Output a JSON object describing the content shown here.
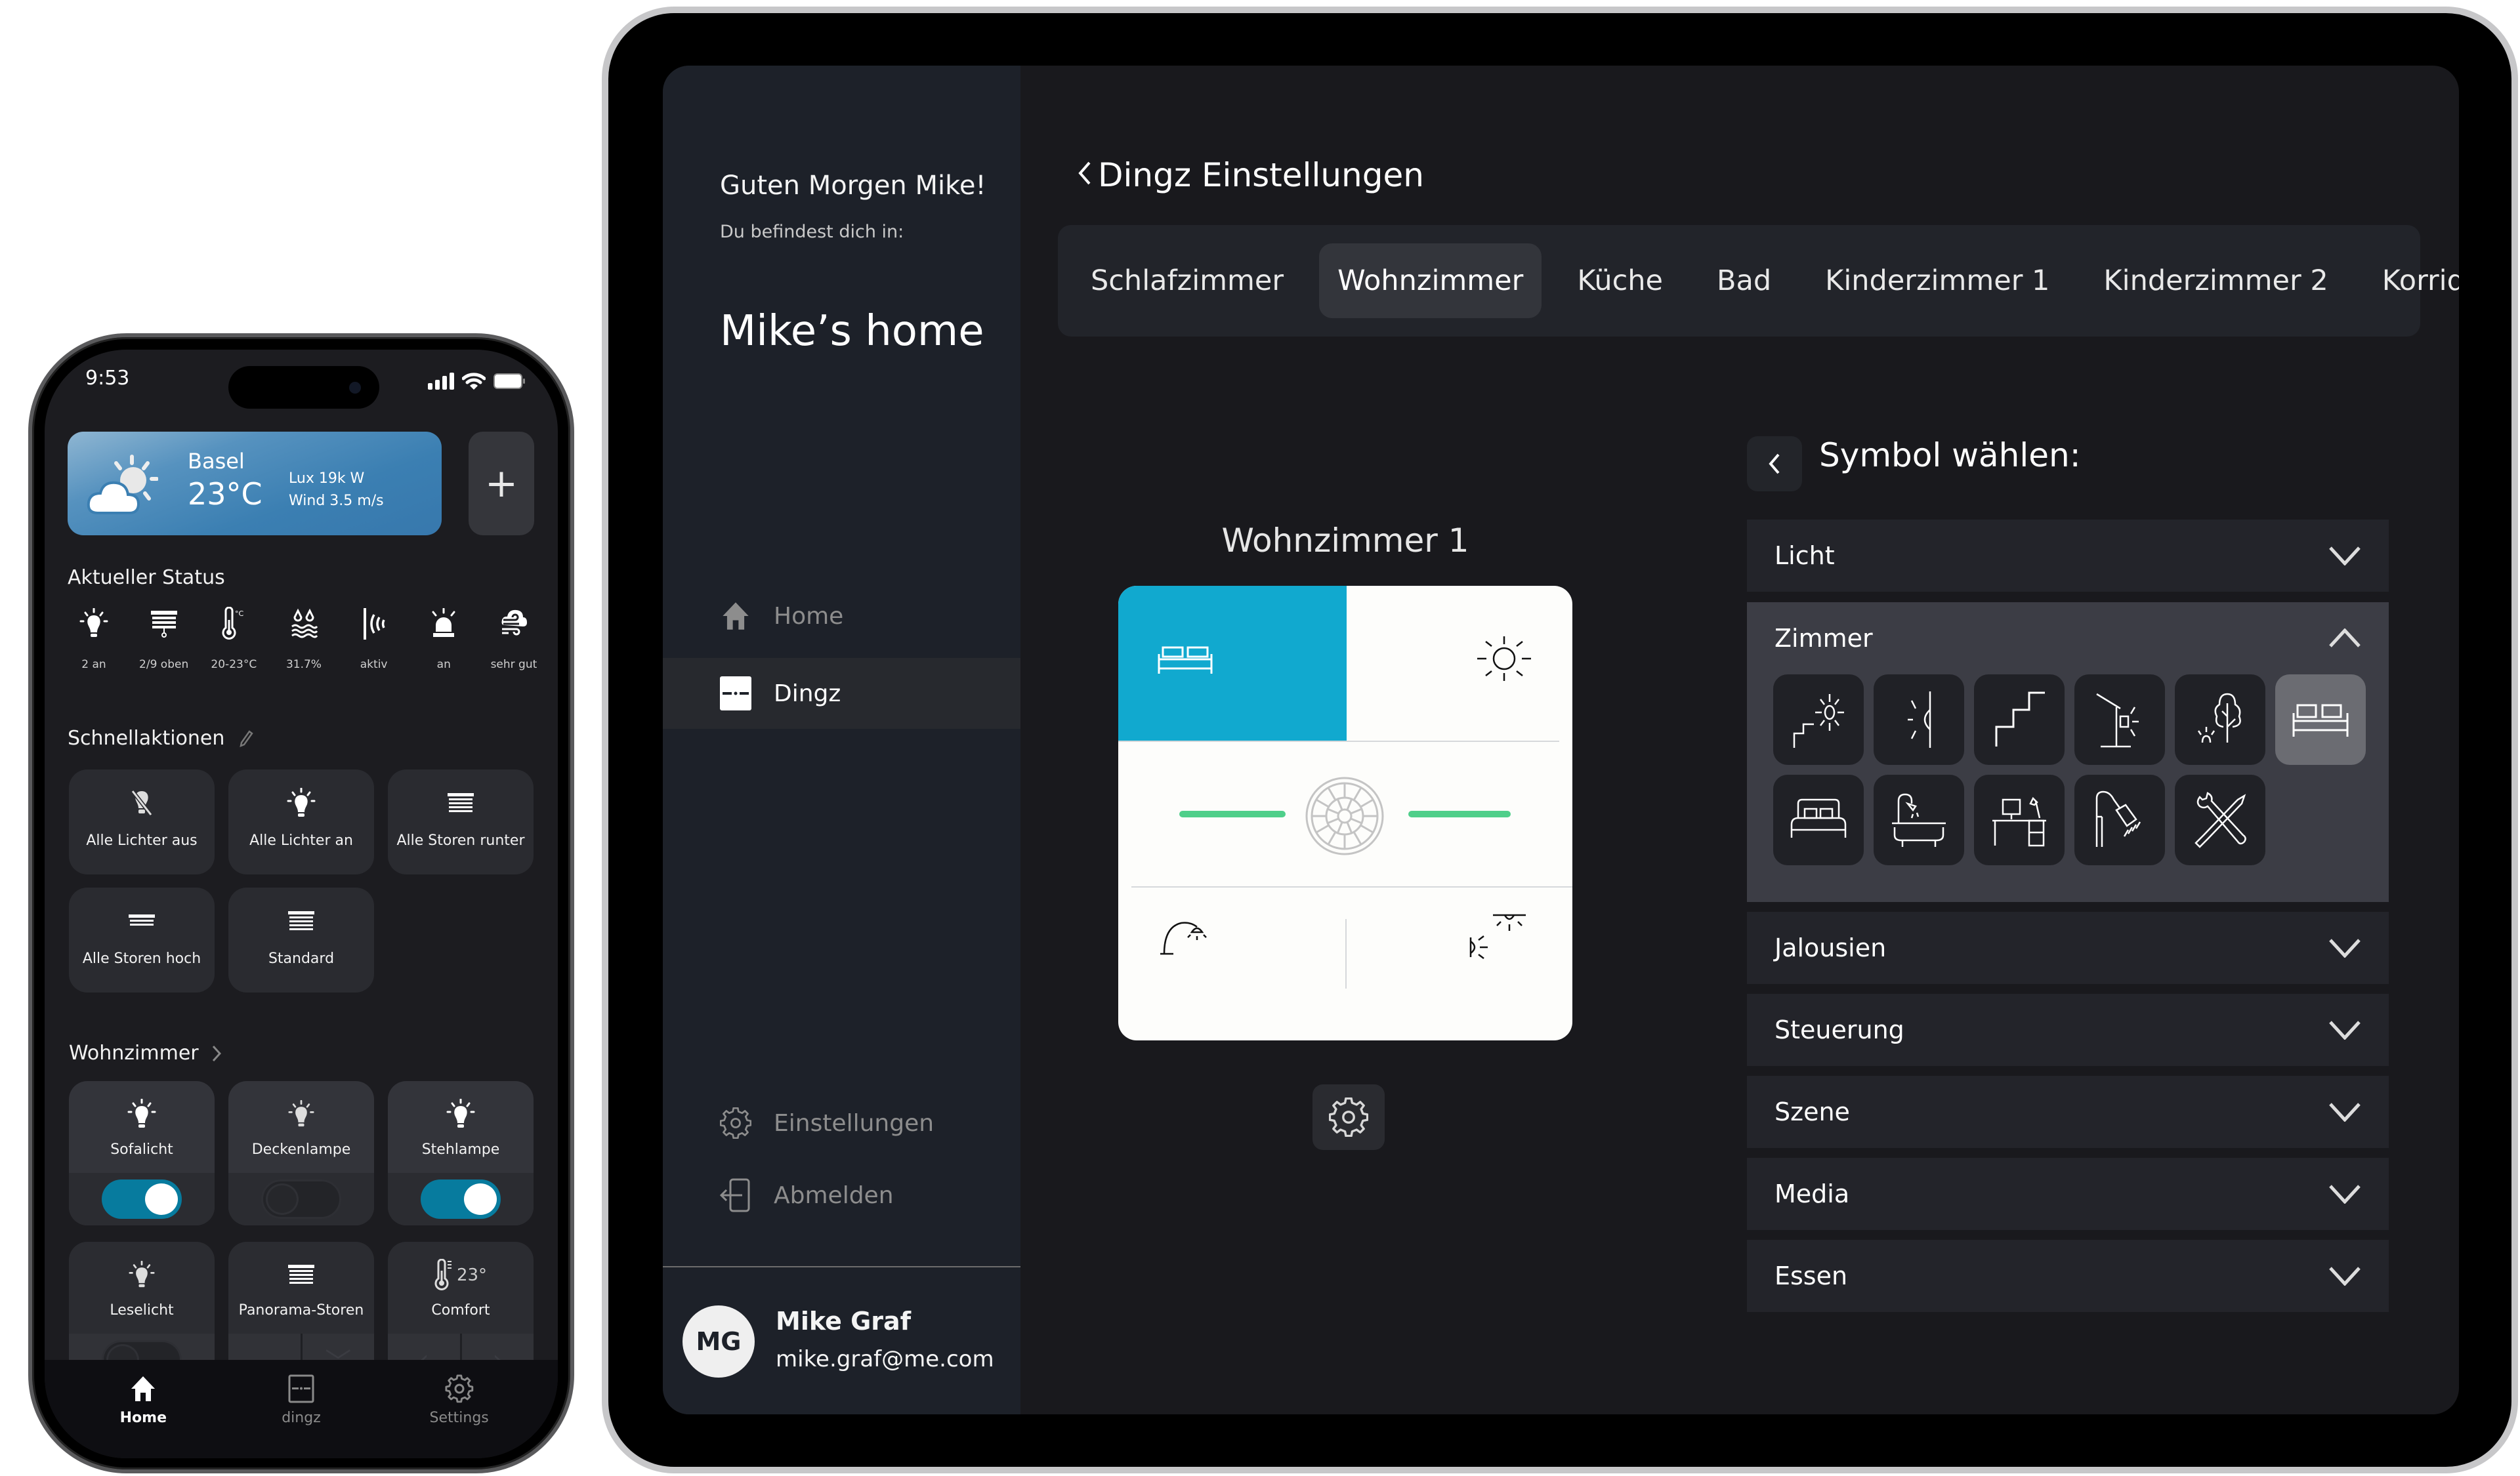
{
  "phone": {
    "status_bar": {
      "time": "9:53"
    },
    "weather": {
      "city": "Basel",
      "temperature": "23°C",
      "lux": "Lux 19k W",
      "wind": "Wind 3.5 m/s",
      "icon": "partly-cloudy-icon"
    },
    "add_label": "+",
    "status_section": {
      "title": "Aktueller Status",
      "items": [
        {
          "icon": "lightbulb-icon",
          "label": "2 an"
        },
        {
          "icon": "blinds-icon",
          "label": "2/9 oben"
        },
        {
          "icon": "thermometer-icon",
          "label": "20-23°C"
        },
        {
          "icon": "humidity-icon",
          "label": "31.7%"
        },
        {
          "icon": "motion-sensor-icon",
          "label": "aktiv"
        },
        {
          "icon": "alarm-siren-icon",
          "label": "an"
        },
        {
          "icon": "air-quality-icon",
          "label": "sehr gut"
        }
      ]
    },
    "quick_actions": {
      "title": "Schnellaktionen",
      "items": [
        {
          "icon": "lightbulb-off-icon",
          "label": "Alle Lichter aus"
        },
        {
          "icon": "lightbulb-icon",
          "label": "Alle Lichter an"
        },
        {
          "icon": "blinds-down-icon",
          "label": "Alle Storen runter"
        },
        {
          "icon": "blinds-up-icon",
          "label": "Alle Storen hoch"
        },
        {
          "icon": "blinds-icon",
          "label": "Standard"
        }
      ]
    },
    "room": {
      "title": "Wohnzimmer",
      "devices": [
        {
          "icon": "lightbulb-icon",
          "label": "Sofalicht",
          "control": "toggle",
          "on": true
        },
        {
          "icon": "lightbulb-icon",
          "label": "Deckenlampe",
          "control": "toggle",
          "on": false
        },
        {
          "icon": "lightbulb-icon",
          "label": "Stehlampe",
          "control": "toggle",
          "on": true
        },
        {
          "icon": "lightbulb-icon",
          "label": "Leselicht",
          "control": "toggle",
          "on": false
        },
        {
          "icon": "blinds-icon",
          "label": "Panorama-Storen",
          "control": "up-down"
        },
        {
          "icon": "thermometer-icon",
          "label": "Comfort",
          "value": "23°",
          "control": "left-right"
        }
      ]
    },
    "tabbar": [
      {
        "icon": "home-icon",
        "label": "Home",
        "active": true
      },
      {
        "icon": "dingz-icon",
        "label": "dingz",
        "active": false
      },
      {
        "icon": "gear-icon",
        "label": "Settings",
        "active": false
      }
    ]
  },
  "ipad": {
    "sidebar": {
      "greeting": "Guten Morgen Mike!",
      "subtitle": "Du befindest dich in:",
      "home_name": "Mike’s home",
      "nav": [
        {
          "icon": "home-icon",
          "label": "Home",
          "active": false
        },
        {
          "icon": "dingz-icon",
          "label": "Dingz",
          "active": true
        }
      ],
      "footer_nav": [
        {
          "icon": "gear-icon",
          "label": "Einstellungen"
        },
        {
          "icon": "logout-icon",
          "label": "Abmelden"
        }
      ],
      "user": {
        "initials": "MG",
        "name": "Mike Graf",
        "email": "mike.graf@me.com"
      }
    },
    "header": {
      "title": "Dingz Einstellungen"
    },
    "room_tabs": [
      {
        "label": "Schlafzimmer",
        "active": false
      },
      {
        "label": "Wohnzimmer",
        "active": true
      },
      {
        "label": "Küche",
        "active": false
      },
      {
        "label": "Bad",
        "active": false
      },
      {
        "label": "Kinderzimmer 1",
        "active": false
      },
      {
        "label": "Kinderzimmer 2",
        "active": false
      },
      {
        "label": "Korridor",
        "active": false
      }
    ],
    "preview": {
      "title": "Wohnzimmer 1",
      "buttons": [
        {
          "position": "top-left",
          "icon": "sofa-icon",
          "selected": true
        },
        {
          "position": "top-right",
          "icon": "sun-icon",
          "selected": false
        },
        {
          "position": "bottom-left",
          "icon": "desk-lamp-icon",
          "selected": false
        },
        {
          "position": "bottom-right",
          "icon": "wall-ceiling-light-icon",
          "selected": false
        }
      ],
      "center_icon": "dimmer-wheel-icon"
    },
    "symbol_picker": {
      "title": "Symbol wählen:",
      "categories": [
        {
          "label": "Licht",
          "expanded": false
        },
        {
          "label": "Zimmer",
          "expanded": true,
          "symbols": [
            {
              "icon": "stairs-light-icon",
              "selected": false
            },
            {
              "icon": "wall-light-icon",
              "selected": false
            },
            {
              "icon": "stairs-icon",
              "selected": false
            },
            {
              "icon": "outdoor-lamp-icon",
              "selected": false
            },
            {
              "icon": "garden-light-icon",
              "selected": false
            },
            {
              "icon": "sofa-icon",
              "selected": true
            },
            {
              "icon": "bed-icon",
              "selected": false
            },
            {
              "icon": "bathtub-icon",
              "selected": false
            },
            {
              "icon": "desk-icon",
              "selected": false
            },
            {
              "icon": "shower-icon",
              "selected": false
            },
            {
              "icon": "tools-icon",
              "selected": false
            }
          ]
        },
        {
          "label": "Jalousien",
          "expanded": false
        },
        {
          "label": "Steuerung",
          "expanded": false
        },
        {
          "label": "Szene",
          "expanded": false
        },
        {
          "label": "Media",
          "expanded": false
        },
        {
          "label": "Essen",
          "expanded": false
        }
      ]
    }
  },
  "colors": {
    "accent_blue": "#11a9cf",
    "toggle_on": "#077b9e",
    "dimmer_green": "#4fcf8a",
    "ipad_sidebar": "#1d2129",
    "ipad_background": "#19191d"
  }
}
